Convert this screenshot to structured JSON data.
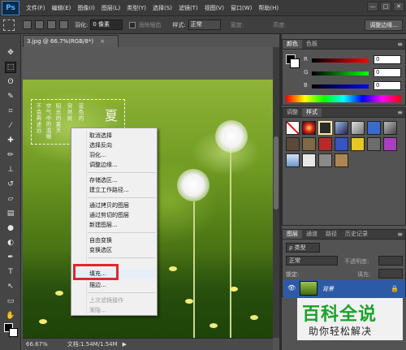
{
  "menubar": {
    "logo": "Ps",
    "items": [
      "文件(F)",
      "编辑(E)",
      "图像(I)",
      "图层(L)",
      "类型(Y)",
      "选择(S)",
      "滤镜(T)",
      "视图(V)",
      "窗口(W)",
      "帮助(H)"
    ],
    "window_controls": [
      "—",
      "□",
      "✕"
    ]
  },
  "optionsbar": {
    "feather_label": "羽化:",
    "feather_value": "0 像素",
    "antialias_label": "消除锯齿",
    "style_label": "样式:",
    "style_value": "正常",
    "width_label": "宽度:",
    "height_label": "高度:",
    "refine_edge": "调整边缘..."
  },
  "document": {
    "tab_title": "3.jpg @ 66.7%(RGB/8*)",
    "tab_close": "×",
    "poem_columns": [
      "不会再述远",
      "空气中的温暖",
      "阳光的夏天",
      "突然就",
      "蓝色的"
    ],
    "poem_big": "夏"
  },
  "context_menu": {
    "items": [
      {
        "label": "取消选择",
        "disabled": false
      },
      {
        "label": "选择反向",
        "disabled": false
      },
      {
        "label": "羽化...",
        "disabled": false
      },
      {
        "label": "调整边缘...",
        "disabled": false
      },
      {
        "label": "存储选区...",
        "disabled": false
      },
      {
        "label": "建立工作路径...",
        "disabled": false
      },
      {
        "label": "通过拷贝的图层",
        "disabled": false
      },
      {
        "label": "通过剪切的图层",
        "disabled": false
      },
      {
        "label": "新建图层...",
        "disabled": false
      },
      {
        "label": "自由变换",
        "disabled": false
      },
      {
        "label": "变换选区",
        "disabled": false
      },
      {
        "label": "填充...",
        "disabled": false
      },
      {
        "label": "描边...",
        "disabled": false
      },
      {
        "label": "上次滤镜操作",
        "disabled": true
      },
      {
        "label": "渐隐...",
        "disabled": true
      }
    ],
    "highlighted": "填充..."
  },
  "status": {
    "zoom": "66.67%",
    "doc_info": "文档:1.54M/1.54M",
    "arrow": "▶"
  },
  "color_panel": {
    "tabs": [
      "颜色",
      "色板"
    ],
    "channels": [
      {
        "label": "R",
        "value": "0"
      },
      {
        "label": "G",
        "value": "0"
      },
      {
        "label": "B",
        "value": "0"
      }
    ]
  },
  "styles_panel": {
    "tabs": [
      "调整",
      "样式"
    ]
  },
  "layers_panel": {
    "tabs": [
      "图层",
      "通道",
      "路径",
      "历史记录"
    ],
    "filter_label": "ρ 类型",
    "blend_mode": "正常",
    "opacity_label": "不透明度:",
    "lock_label": "锁定:",
    "fill_label": "填充:",
    "layer_name": "背景",
    "eye": "👁",
    "lock_icon": "🔒"
  },
  "watermark": {
    "title": "百科全说",
    "subtitle": "助你轻松解决"
  },
  "colors": {
    "highlight": "#e1262e",
    "layer_selected": "#2d5aa7",
    "watermark_green": "#1aa32a"
  }
}
